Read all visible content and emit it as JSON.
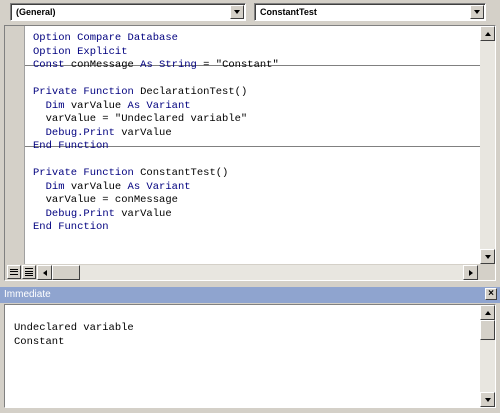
{
  "toolbar": {
    "object_combo": "(General)",
    "procedure_combo": "ConstantTest"
  },
  "code": {
    "lines": [
      [
        {
          "t": "Option Compare Database",
          "k": true
        }
      ],
      [
        {
          "t": "Option Explicit",
          "k": true
        }
      ],
      [
        {
          "t": "Const",
          "k": true
        },
        {
          "t": " conMessage "
        },
        {
          "t": "As String",
          "k": true
        },
        {
          "t": " = \"Constant\""
        }
      ],
      [],
      [
        {
          "t": "Private Function",
          "k": true
        },
        {
          "t": " DeclarationTest()"
        }
      ],
      [
        {
          "t": "  "
        },
        {
          "t": "Dim",
          "k": true
        },
        {
          "t": " varValue "
        },
        {
          "t": "As Variant",
          "k": true
        }
      ],
      [
        {
          "t": "  varValue = \"Undeclared variable\""
        }
      ],
      [
        {
          "t": "  "
        },
        {
          "t": "Debug.Print",
          "k": true
        },
        {
          "t": " varValue"
        }
      ],
      [
        {
          "t": "End Function",
          "k": true
        }
      ],
      [],
      [
        {
          "t": "Private Function",
          "k": true
        },
        {
          "t": " ConstantTest()"
        }
      ],
      [
        {
          "t": "  "
        },
        {
          "t": "Dim",
          "k": true
        },
        {
          "t": " varValue "
        },
        {
          "t": "As Variant",
          "k": true
        }
      ],
      [
        {
          "t": "  varValue = conMessage"
        }
      ],
      [
        {
          "t": "  "
        },
        {
          "t": "Debug.Print",
          "k": true
        },
        {
          "t": " varValue"
        }
      ],
      [
        {
          "t": "End Function",
          "k": true
        }
      ]
    ]
  },
  "immediate": {
    "title": "Immediate",
    "close_label": "×",
    "output": [
      "Undeclared variable",
      "Constant"
    ]
  },
  "colors": {
    "keyword": "#00007f",
    "title_bar": "#8fa4cf"
  },
  "icons": [
    "chevron-down-icon",
    "procedure-view-icon",
    "full-module-view-icon",
    "scroll-left-icon",
    "scroll-right-icon",
    "scroll-up-icon",
    "scroll-down-icon",
    "close-icon"
  ]
}
